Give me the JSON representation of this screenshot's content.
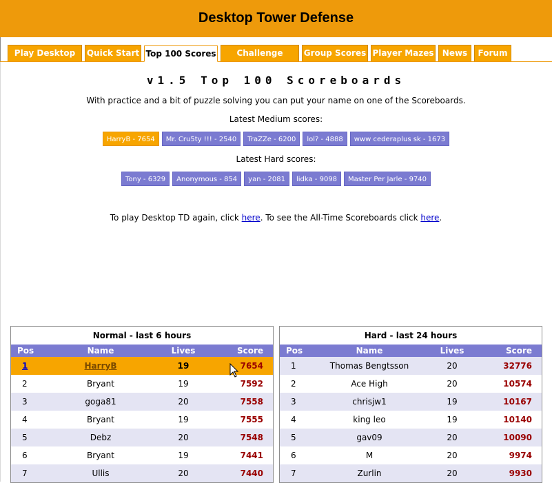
{
  "header": {
    "title": "Desktop Tower Defense"
  },
  "tabs": [
    {
      "label": "Play Desktop TD",
      "active": false
    },
    {
      "label": "Quick Start",
      "active": false
    },
    {
      "label": "Top 100 Scores",
      "active": true
    },
    {
      "label": "Challenge Scores",
      "active": false
    },
    {
      "label": "Group Scores",
      "active": false
    },
    {
      "label": "Player Mazes",
      "active": false
    },
    {
      "label": "News",
      "active": false
    },
    {
      "label": "Forum",
      "active": false
    }
  ],
  "main": {
    "title": "v1.5 Top 100 Scoreboards",
    "intro": "With practice and a bit of puzzle solving you can put your name on one of the Scoreboards.",
    "medium_label": "Latest Medium scores:",
    "medium_scores": [
      "HarryB - 7654",
      "Mr. Cru5ty !!! - 2540",
      "TraZZe - 6200",
      "lol? - 4888",
      "www cederaplus sk - 1673"
    ],
    "hard_label": "Latest Hard scores:",
    "hard_scores": [
      "Tony - 6329",
      "Anonymous - 854",
      "yan - 2081",
      "lidka - 9098",
      "Master Per Jarle - 9740"
    ],
    "play_again": {
      "prefix": "To play Desktop TD again, click ",
      "link1": "here",
      "middle": ". To see the All-Time Scoreboards click ",
      "link2": "here",
      "suffix": "."
    }
  },
  "boards": {
    "columns": [
      "Pos",
      "Name",
      "Lives",
      "Score"
    ],
    "normal": {
      "title": "Normal - last 6 hours",
      "rows": [
        {
          "pos": "1",
          "name": "HarryB",
          "lives": "19",
          "score": "7654"
        },
        {
          "pos": "2",
          "name": "Bryant",
          "lives": "19",
          "score": "7592"
        },
        {
          "pos": "3",
          "name": "goga81",
          "lives": "20",
          "score": "7558"
        },
        {
          "pos": "4",
          "name": "Bryant",
          "lives": "19",
          "score": "7555"
        },
        {
          "pos": "5",
          "name": "Debz",
          "lives": "20",
          "score": "7548"
        },
        {
          "pos": "6",
          "name": "Bryant",
          "lives": "19",
          "score": "7441"
        },
        {
          "pos": "7",
          "name": "Ullis",
          "lives": "20",
          "score": "7440"
        }
      ]
    },
    "hard": {
      "title": "Hard - last 24 hours",
      "rows": [
        {
          "pos": "1",
          "name": "Thomas Bengtsson",
          "lives": "20",
          "score": "32776"
        },
        {
          "pos": "2",
          "name": "Ace High",
          "lives": "20",
          "score": "10574"
        },
        {
          "pos": "3",
          "name": "chrisjw1",
          "lives": "19",
          "score": "10167"
        },
        {
          "pos": "4",
          "name": "king leo",
          "lives": "19",
          "score": "10140"
        },
        {
          "pos": "5",
          "name": "gav09",
          "lives": "20",
          "score": "10090"
        },
        {
          "pos": "6",
          "name": "M",
          "lives": "20",
          "score": "9974"
        },
        {
          "pos": "7",
          "name": "Zurlin",
          "lives": "20",
          "score": "9930"
        }
      ]
    }
  },
  "colors": {
    "orange": "#ee9a0b",
    "purple": "#7b7bd1",
    "score_red": "#990000"
  }
}
